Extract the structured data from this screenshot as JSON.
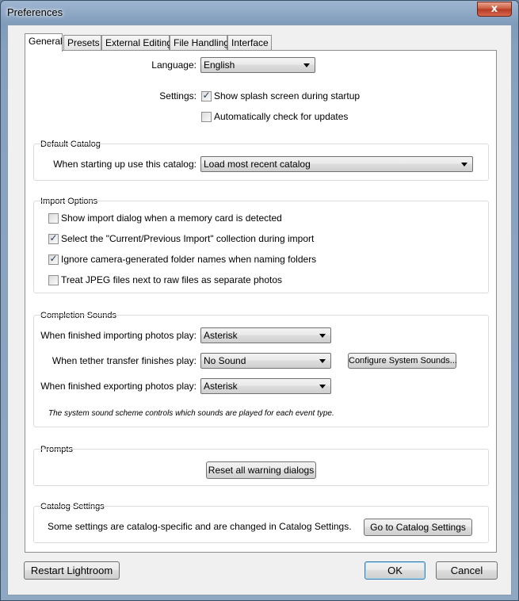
{
  "window": {
    "title": "Preferences",
    "close_symbol": "x"
  },
  "tabs": [
    {
      "label": "General",
      "active": true
    },
    {
      "label": "Presets",
      "active": false
    },
    {
      "label": "External Editing",
      "active": false
    },
    {
      "label": "File Handling",
      "active": false
    },
    {
      "label": "Interface",
      "active": false
    }
  ],
  "general": {
    "language_label": "Language:",
    "language_value": "English",
    "settings_label": "Settings:",
    "splash_label": "Show splash screen during startup",
    "splash_checked": true,
    "updates_label": "Automatically check for updates",
    "updates_checked": false
  },
  "default_catalog": {
    "title": "Default Catalog",
    "label": "When starting up use this catalog:",
    "value": "Load most recent catalog"
  },
  "import_options": {
    "title": "Import Options",
    "items": [
      {
        "label": "Show import dialog when a memory card is detected",
        "checked": false
      },
      {
        "label": "Select the \"Current/Previous Import\" collection during import",
        "checked": true
      },
      {
        "label": "Ignore camera-generated folder names when naming folders",
        "checked": true
      },
      {
        "label": "Treat JPEG files next to raw files as separate photos",
        "checked": false
      }
    ]
  },
  "completion_sounds": {
    "title": "Completion Sounds",
    "importing_label": "When finished importing photos play:",
    "importing_value": "Asterisk",
    "tether_label": "When tether transfer finishes play:",
    "tether_value": "No Sound",
    "configure_button": "Configure System Sounds...",
    "exporting_label": "When finished exporting photos play:",
    "exporting_value": "Asterisk",
    "note": "The system sound scheme controls which sounds are played for each event type."
  },
  "prompts": {
    "title": "Prompts",
    "reset_button": "Reset all warning dialogs"
  },
  "catalog_settings": {
    "title": "Catalog Settings",
    "text": "Some settings are catalog-specific and are changed in Catalog Settings.",
    "button": "Go to Catalog Settings"
  },
  "footer": {
    "restart_button": "Restart Lightroom",
    "ok_button": "OK",
    "cancel_button": "Cancel"
  },
  "check_mark": "✓"
}
